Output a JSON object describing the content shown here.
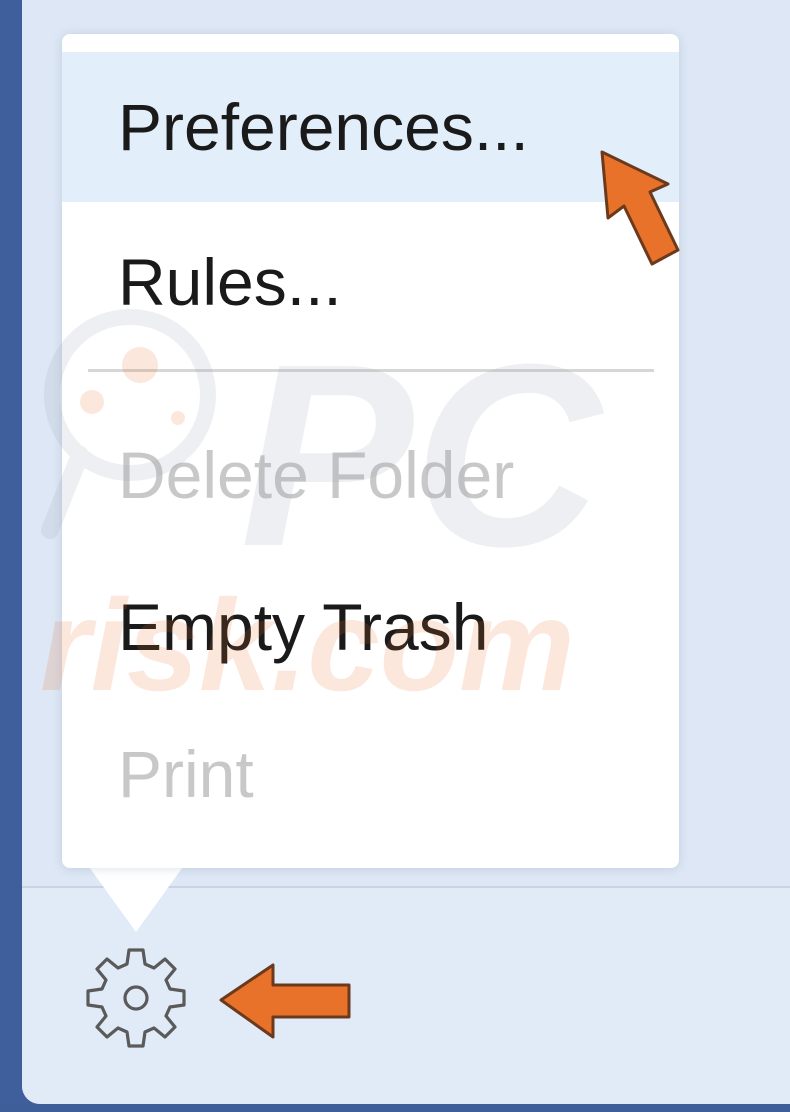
{
  "menu": {
    "items": [
      {
        "label": "Preferences...",
        "state": "highlighted"
      },
      {
        "label": "Rules...",
        "state": "enabled"
      },
      {
        "label": "Delete Folder",
        "state": "disabled"
      },
      {
        "label": "Empty Trash",
        "state": "enabled"
      },
      {
        "label": "Print",
        "state": "disabled"
      }
    ]
  },
  "toolbar": {
    "gear_icon": "gear-icon"
  },
  "watermark": {
    "line1": "PC",
    "line2": "risk.com"
  },
  "colors": {
    "highlight": "#e3eefb",
    "arrow": "#e8722a",
    "panel": "#dde7f5",
    "edge": "#3f5f9c"
  }
}
